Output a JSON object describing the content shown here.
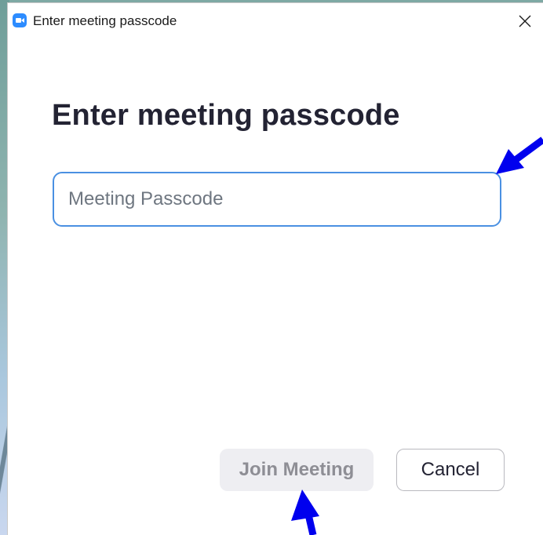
{
  "window": {
    "title": "Enter meeting passcode",
    "app_icon": "zoom-camera-icon",
    "close_icon": "close-icon"
  },
  "dialog": {
    "heading": "Enter meeting passcode",
    "passcode_input": {
      "value": "",
      "placeholder": "Meeting Passcode"
    },
    "join_button_label": "Join Meeting",
    "cancel_button_label": "Cancel"
  },
  "annotations": {
    "arrow_color": "#0000ee",
    "arrows": [
      "arrow-to-passcode-input",
      "arrow-to-join-button"
    ]
  },
  "colors": {
    "accent": "#4a90e2",
    "heading_text": "#232333",
    "disabled_button_bg": "#eeeef2",
    "disabled_button_text": "#8e8e95"
  }
}
